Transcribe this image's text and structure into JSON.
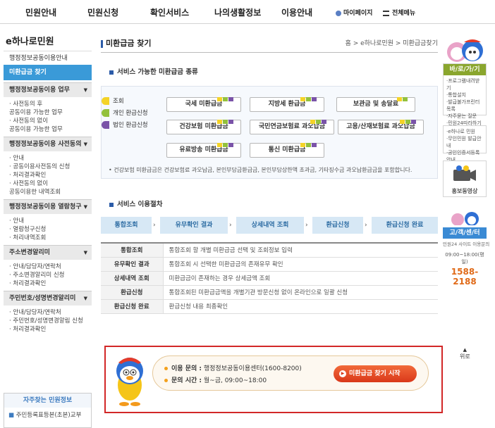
{
  "topnav": {
    "items": [
      "민원안내",
      "민원신청",
      "확인서비스",
      "나의생활정보",
      "이용안내"
    ],
    "mypage": "마이페이지",
    "allmenu": "전체메뉴"
  },
  "sidebar": {
    "title": "e하나로민원",
    "intro": "행정정보공동이용안내",
    "active": "미환급금 찾기",
    "sections": [
      {
        "head": "행정정보공동이용 업무",
        "items": [
          "· 사전동의 후",
          "  공동이용 가능한 업무",
          "· 사전동의 없이",
          "  공동이용 가능한 업무"
        ]
      },
      {
        "head": "행정정보공동이용 사전동의",
        "items": [
          "· 안내",
          "· 공동이용사전동의 신청",
          "· 처리결과확인",
          "· 사전동의 없이",
          "  공동이용한 내역조회"
        ]
      },
      {
        "head": "행정정보공동이용 열람청구",
        "items": [
          "· 안내",
          "· 열람청구신청",
          "· 처리내역조회"
        ]
      },
      {
        "head": "주소변경알리미",
        "items": [
          "· 안내/담당자/연락처",
          "· 주소변경알리미 신청",
          "· 처리결과확인"
        ]
      },
      {
        "head": "주민번호/성명변경알리미",
        "items": [
          "· 안내/담당자/연락처",
          "· 주민번호/성명변경알림 신청",
          "· 처리결과확인"
        ]
      }
    ],
    "faq": {
      "title": "자주찾는 민원정보",
      "item": "주민등록표등본(초본)교부"
    }
  },
  "main": {
    "title": "미환급금 찾기",
    "breadcrumb": "홈 > e하나로민원 > 미환급금찾기",
    "section1": "서비스 가능한 미환급금 종류",
    "legend": [
      {
        "label": "조회",
        "color": "#f4d327"
      },
      {
        "label": "개인 환급신청",
        "color": "#93c13c"
      },
      {
        "label": "법인 환급신청",
        "color": "#7a53a8"
      }
    ],
    "refunds": [
      "국세 미환급금",
      "지방세 환급금",
      "보관금 및 송달료",
      "건강보험 미환급금",
      "국민연금보험료 과오납금",
      "고용/산재보험료 과오납금",
      "유료방송 미환급금",
      "통신 미환급금"
    ],
    "note": "• 건강보험 미환급금은 건강보험료 과오납금, 본인부담금환급금, 본인부담상한액 초과금, 기타징수금 과오납환급금을 포함합니다.",
    "section2": "서비스 이용절차",
    "steps": [
      "통합조회",
      "유무확인 결과",
      "상세내역 조회",
      "환급신청",
      "환급신청 완료"
    ],
    "process": [
      {
        "k": "통합조회",
        "v": "통합조회 할 개별 미환급금 선택 및 조회정보 입력"
      },
      {
        "k": "유무확인 결과",
        "v": "통합조회 시 선택한 미환급금의 존재유무 확인"
      },
      {
        "k": "상세내역 조회",
        "v": "미환급금이 존재하는 경우 상세금액 조회"
      },
      {
        "k": "환급신청",
        "v": "통합조회된 미환급금액을 개별기관 방문신청 없이 온라인으로 일괄 신청"
      },
      {
        "k": "환급신청 완료",
        "v": "환급신청 내용 최종확인"
      }
    ],
    "contact": {
      "label1": "이용 문의 :",
      "value1": "행정정보공동이용센터(1600-8200)",
      "label2": "문의 시간 :",
      "value2": "월~금, 09:00~18:00",
      "button": "미환급금 찾기 시작"
    }
  },
  "right": {
    "quick": "바/로/가/기",
    "quick_items": [
      "·프로그램내려받기",
      "·통합설치",
      "·발급불가프린터목록",
      "·자주묻는 질문",
      "·민원24따라하기"
    ],
    "links": [
      "·e하나로 민원",
      "·무인민원 발급안내",
      "·공인인증서등록안내"
    ],
    "promo": "홍보동영상",
    "center": "고/객/센/터",
    "center_sub": "민원24 사이트 이용문의",
    "hours": "09:00~18:00(평일)",
    "phone": "1588-2188",
    "top": "위로"
  }
}
